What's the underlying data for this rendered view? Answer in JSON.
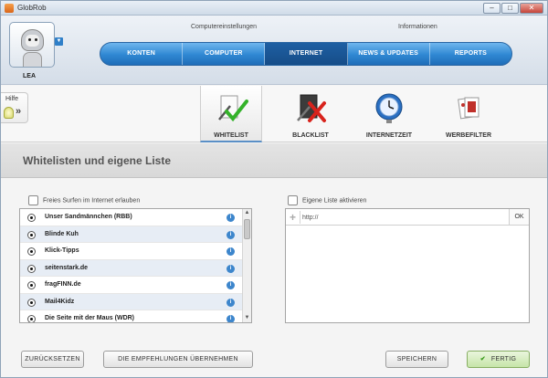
{
  "window": {
    "title": "GlobRob",
    "controls": [
      "–",
      "□",
      "✕"
    ]
  },
  "user": {
    "name": "LEA"
  },
  "nav": {
    "groups": [
      "Computereinstellungen",
      "Informationen"
    ],
    "tabs": [
      {
        "label": "KONTEN"
      },
      {
        "label": "COMPUTER"
      },
      {
        "label": "INTERNET",
        "active": true
      },
      {
        "label": "NEWS & UPDATES"
      },
      {
        "label": "REPORTS"
      }
    ]
  },
  "help": {
    "label": "Hilfe",
    "arrow": "»"
  },
  "toolbar": {
    "tools": [
      {
        "label": "WHITELIST",
        "icon": "whitelist-check-icon",
        "active": true
      },
      {
        "label": "BLACKLIST",
        "icon": "blacklist-x-icon"
      },
      {
        "label": "INTERNETZEIT",
        "icon": "clock-icon"
      },
      {
        "label": "WERBEFILTER",
        "icon": "cards-icon"
      }
    ]
  },
  "section": {
    "title": "Whitelisten und eigene Liste"
  },
  "whitelist": {
    "free_surf_label": "Freies Surfen im Internet erlauben",
    "items": [
      "Unser Sandmännchen (RBB)",
      "Blinde Kuh",
      "Klick-Tipps",
      "seitenstark.de",
      "fragFINN.de",
      "Mail4Kidz",
      "Die Seite mit der Maus (WDR)"
    ],
    "info_glyph": "i"
  },
  "own_list": {
    "enable_label": "Eigene Liste aktivieren",
    "url_value": "http://",
    "ok_label": "OK"
  },
  "buttons": {
    "reset": "ZURÜCKSETZEN",
    "recommend": "DIE EMPFEHLUNGEN ÜBERNEHMEN",
    "save": "SPEICHERN",
    "done": "FERTIG",
    "done_check": "✔"
  },
  "colors": {
    "accent": "#2f87d2",
    "active_tab": "#1a5596",
    "done_green": "#c6e5a8"
  }
}
